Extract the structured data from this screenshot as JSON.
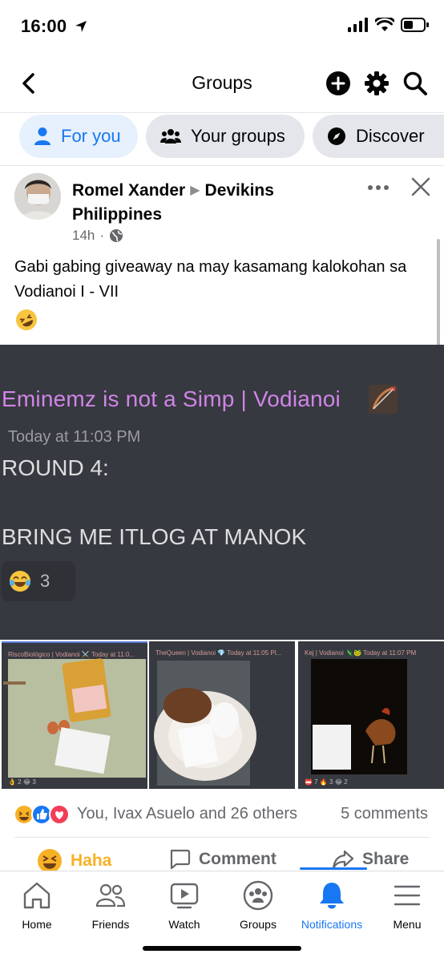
{
  "status_bar": {
    "time": "16:00"
  },
  "header": {
    "title": "Groups"
  },
  "tabs": [
    {
      "label": "For you",
      "icon": "person-icon",
      "active": true
    },
    {
      "label": "Your groups",
      "icon": "people-icon",
      "active": false
    },
    {
      "label": "Discover",
      "icon": "compass-icon",
      "active": false
    }
  ],
  "post": {
    "author": "Romel Xander",
    "group": "Devikins Philippines",
    "time": "14h",
    "text": "Gabi gabing giveaway na may kasamang kalokohan sa Vodianoi I - VII",
    "text_emoji": "🤣",
    "image": {
      "username": "Eminemz is not a Simp | Vodianoi",
      "timestamp": "Today at 11:03 PM",
      "line1": "ROUND 4:",
      "line2": "BRING ME ITLOG AT MANOK",
      "reaction_emoji": "😂",
      "reaction_count": "3"
    },
    "thumbnails": [
      {
        "title": "RiscoBiológico | Vodianoi ⚔️ Today at 11:0...",
        "reactions": "👌 2  😂 3"
      },
      {
        "title": "TheQueen | Vodianoi 💎 Today at 11:05 Pl...",
        "reactions": ""
      },
      {
        "title": "Kej | Vodianoi 🦎🐸 Today at 11:07 PM",
        "reactions": "📛 7  🔥 3  😂 2"
      }
    ],
    "reactions_text": "You, Ivax Asuelo and 26 others",
    "comments_text": "5 comments",
    "actions": {
      "haha": "Haha",
      "comment": "Comment",
      "share": "Share"
    }
  },
  "bottom_nav": [
    {
      "label": "Home",
      "icon": "home-icon",
      "active": false
    },
    {
      "label": "Friends",
      "icon": "friends-icon",
      "active": false
    },
    {
      "label": "Watch",
      "icon": "watch-icon",
      "active": false
    },
    {
      "label": "Groups",
      "icon": "groups-icon",
      "active": false
    },
    {
      "label": "Notifications",
      "icon": "bell-icon",
      "active": true
    },
    {
      "label": "Menu",
      "icon": "menu-icon",
      "active": false
    }
  ],
  "colors": {
    "accent": "#1877f2",
    "discord_bg": "#36393f",
    "discord_name": "#d084e8",
    "haha": "#f7b125"
  }
}
